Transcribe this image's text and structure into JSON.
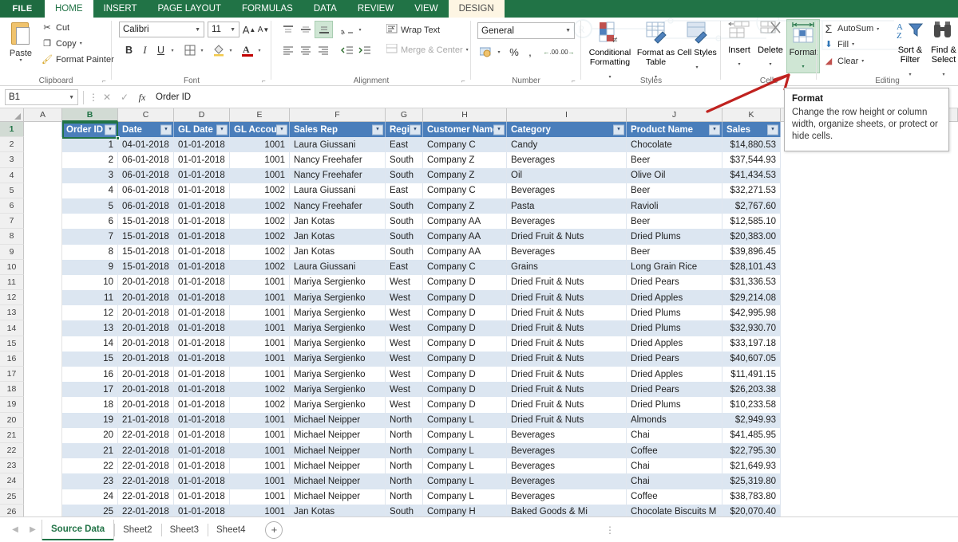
{
  "ribbon": {
    "file_tab": "FILE",
    "tabs": [
      {
        "label": "HOME",
        "state": "active"
      },
      {
        "label": "INSERT",
        "state": "normal"
      },
      {
        "label": "PAGE LAYOUT",
        "state": "normal"
      },
      {
        "label": "FORMULAS",
        "state": "normal"
      },
      {
        "label": "DATA",
        "state": "normal"
      },
      {
        "label": "REVIEW",
        "state": "normal"
      },
      {
        "label": "VIEW",
        "state": "normal"
      },
      {
        "label": "DESIGN",
        "state": "contextual"
      }
    ],
    "groups": {
      "clipboard": {
        "label": "Clipboard",
        "paste": "Paste",
        "cut": "Cut",
        "copy": "Copy",
        "format_painter": "Format Painter"
      },
      "font": {
        "label": "Font",
        "font_name": "Calibri",
        "font_size": "11",
        "grow_font": "A",
        "shrink_font": "A",
        "bold": "B",
        "italic": "I",
        "underline": "U"
      },
      "alignment": {
        "label": "Alignment",
        "wrap_text": "Wrap Text",
        "merge_center": "Merge & Center"
      },
      "number": {
        "label": "Number",
        "format": "General",
        "percent": "%",
        "comma": ",",
        "increase_decimal": ".00",
        "decrease_decimal": ".00"
      },
      "styles": {
        "label": "Styles",
        "conditional_formatting": "Conditional Formatting",
        "format_as_table": "Format as Table",
        "cell_styles": "Cell Styles"
      },
      "cells": {
        "label": "Cells",
        "insert": "Insert",
        "delete": "Delete",
        "format": "Format"
      },
      "editing": {
        "label": "Editing",
        "autosum": "AutoSum",
        "fill": "Fill",
        "clear": "Clear",
        "sort_filter": "Sort & Filter",
        "find_select": "Find & Select"
      }
    }
  },
  "tooltip": {
    "title": "Format",
    "body": "Change the row height or column width, organize sheets, or protect or hide cells."
  },
  "formula_bar": {
    "name_box": "B1",
    "value": "Order ID",
    "cancel_icon": "times-icon",
    "confirm_icon": "check-icon",
    "function_icon": "fx-icon"
  },
  "grid": {
    "column_letters": [
      "A",
      "B",
      "C",
      "D",
      "E",
      "F",
      "G",
      "H",
      "I",
      "J",
      "K"
    ],
    "selected_column": "B",
    "selected_row": "1",
    "selected_cell": "B1",
    "headers": [
      "Order ID",
      "Date",
      "GL Date",
      "GL Account",
      "Sales Rep",
      "Region",
      "Customer Name",
      "Category",
      "Product Name",
      "Sales"
    ],
    "rows": [
      {
        "n": "2",
        "cells": [
          "1",
          "04-01-2018",
          "01-01-2018",
          "1001",
          "Laura Giussani",
          "East",
          "Company C",
          "Candy",
          "Chocolate",
          "$14,880.53"
        ]
      },
      {
        "n": "3",
        "cells": [
          "2",
          "06-01-2018",
          "01-01-2018",
          "1001",
          "Nancy Freehafer",
          "South",
          "Company Z",
          "Beverages",
          "Beer",
          "$37,544.93"
        ]
      },
      {
        "n": "4",
        "cells": [
          "3",
          "06-01-2018",
          "01-01-2018",
          "1001",
          "Nancy Freehafer",
          "South",
          "Company Z",
          "Oil",
          "Olive Oil",
          "$41,434.53"
        ]
      },
      {
        "n": "5",
        "cells": [
          "4",
          "06-01-2018",
          "01-01-2018",
          "1002",
          "Laura Giussani",
          "East",
          "Company C",
          "Beverages",
          "Beer",
          "$32,271.53"
        ]
      },
      {
        "n": "6",
        "cells": [
          "5",
          "06-01-2018",
          "01-01-2018",
          "1002",
          "Nancy Freehafer",
          "South",
          "Company Z",
          "Pasta",
          "Ravioli",
          "$2,767.60"
        ]
      },
      {
        "n": "7",
        "cells": [
          "6",
          "15-01-2018",
          "01-01-2018",
          "1002",
          "Jan Kotas",
          "South",
          "Company AA",
          "Beverages",
          "Beer",
          "$12,585.10"
        ]
      },
      {
        "n": "8",
        "cells": [
          "7",
          "15-01-2018",
          "01-01-2018",
          "1002",
          "Jan Kotas",
          "South",
          "Company AA",
          "Dried Fruit & Nuts",
          "Dried Plums",
          "$20,383.00"
        ]
      },
      {
        "n": "9",
        "cells": [
          "8",
          "15-01-2018",
          "01-01-2018",
          "1002",
          "Jan Kotas",
          "South",
          "Company AA",
          "Beverages",
          "Beer",
          "$39,896.45"
        ]
      },
      {
        "n": "10",
        "cells": [
          "9",
          "15-01-2018",
          "01-01-2018",
          "1002",
          "Laura Giussani",
          "East",
          "Company C",
          "Grains",
          "Long Grain Rice",
          "$28,101.43"
        ]
      },
      {
        "n": "11",
        "cells": [
          "10",
          "20-01-2018",
          "01-01-2018",
          "1001",
          "Mariya Sergienko",
          "West",
          "Company D",
          "Dried Fruit & Nuts",
          "Dried Pears",
          "$31,336.53"
        ]
      },
      {
        "n": "12",
        "cells": [
          "11",
          "20-01-2018",
          "01-01-2018",
          "1001",
          "Mariya Sergienko",
          "West",
          "Company D",
          "Dried Fruit & Nuts",
          "Dried Apples",
          "$29,214.08"
        ]
      },
      {
        "n": "13",
        "cells": [
          "12",
          "20-01-2018",
          "01-01-2018",
          "1001",
          "Mariya Sergienko",
          "West",
          "Company D",
          "Dried Fruit & Nuts",
          "Dried Plums",
          "$42,995.98"
        ]
      },
      {
        "n": "14",
        "cells": [
          "13",
          "20-01-2018",
          "01-01-2018",
          "1001",
          "Mariya Sergienko",
          "West",
          "Company D",
          "Dried Fruit & Nuts",
          "Dried Plums",
          "$32,930.70"
        ]
      },
      {
        "n": "15",
        "cells": [
          "14",
          "20-01-2018",
          "01-01-2018",
          "1001",
          "Mariya Sergienko",
          "West",
          "Company D",
          "Dried Fruit & Nuts",
          "Dried Apples",
          "$33,197.18"
        ]
      },
      {
        "n": "16",
        "cells": [
          "15",
          "20-01-2018",
          "01-01-2018",
          "1001",
          "Mariya Sergienko",
          "West",
          "Company D",
          "Dried Fruit & Nuts",
          "Dried Pears",
          "$40,607.05"
        ]
      },
      {
        "n": "17",
        "cells": [
          "16",
          "20-01-2018",
          "01-01-2018",
          "1001",
          "Mariya Sergienko",
          "West",
          "Company D",
          "Dried Fruit & Nuts",
          "Dried Apples",
          "$11,491.15"
        ]
      },
      {
        "n": "18",
        "cells": [
          "17",
          "20-01-2018",
          "01-01-2018",
          "1002",
          "Mariya Sergienko",
          "West",
          "Company D",
          "Dried Fruit & Nuts",
          "Dried Pears",
          "$26,203.38"
        ]
      },
      {
        "n": "19",
        "cells": [
          "18",
          "20-01-2018",
          "01-01-2018",
          "1002",
          "Mariya Sergienko",
          "West",
          "Company D",
          "Dried Fruit & Nuts",
          "Dried Plums",
          "$10,233.58"
        ]
      },
      {
        "n": "20",
        "cells": [
          "19",
          "21-01-2018",
          "01-01-2018",
          "1001",
          "Michael Neipper",
          "North",
          "Company L",
          "Dried Fruit & Nuts",
          "Almonds",
          "$2,949.93"
        ]
      },
      {
        "n": "21",
        "cells": [
          "20",
          "22-01-2018",
          "01-01-2018",
          "1001",
          "Michael Neipper",
          "North",
          "Company L",
          "Beverages",
          "Chai",
          "$41,485.95"
        ]
      },
      {
        "n": "22",
        "cells": [
          "21",
          "22-01-2018",
          "01-01-2018",
          "1001",
          "Michael Neipper",
          "North",
          "Company L",
          "Beverages",
          "Coffee",
          "$22,795.30"
        ]
      },
      {
        "n": "23",
        "cells": [
          "22",
          "22-01-2018",
          "01-01-2018",
          "1001",
          "Michael Neipper",
          "North",
          "Company L",
          "Beverages",
          "Chai",
          "$21,649.93"
        ]
      },
      {
        "n": "24",
        "cells": [
          "23",
          "22-01-2018",
          "01-01-2018",
          "1001",
          "Michael Neipper",
          "North",
          "Company L",
          "Beverages",
          "Chai",
          "$25,319.80"
        ]
      },
      {
        "n": "25",
        "cells": [
          "24",
          "22-01-2018",
          "01-01-2018",
          "1001",
          "Michael Neipper",
          "North",
          "Company L",
          "Beverages",
          "Coffee",
          "$38,783.80"
        ]
      },
      {
        "n": "26",
        "cells": [
          "25",
          "22-01-2018",
          "01-01-2018",
          "1001",
          "Jan Kotas",
          "South",
          "Company H",
          "Baked Goods & Mi",
          "Chocolate Biscuits M",
          "$20,070.40"
        ]
      }
    ]
  },
  "sheet_tabs": {
    "prev_icon": "chevron-left-icon",
    "next_icon": "chevron-right-icon",
    "tabs": [
      {
        "label": "Source Data",
        "active": true
      },
      {
        "label": "Sheet2",
        "active": false
      },
      {
        "label": "Sheet3",
        "active": false
      },
      {
        "label": "Sheet4",
        "active": false
      }
    ],
    "add_label": "+"
  },
  "colors": {
    "excel_green": "#217346",
    "table_header_blue": "#4a7ebb",
    "band_blue": "#dce6f1",
    "highlight_green": "#cfe6d4",
    "annotation_red": "#c0221f"
  }
}
